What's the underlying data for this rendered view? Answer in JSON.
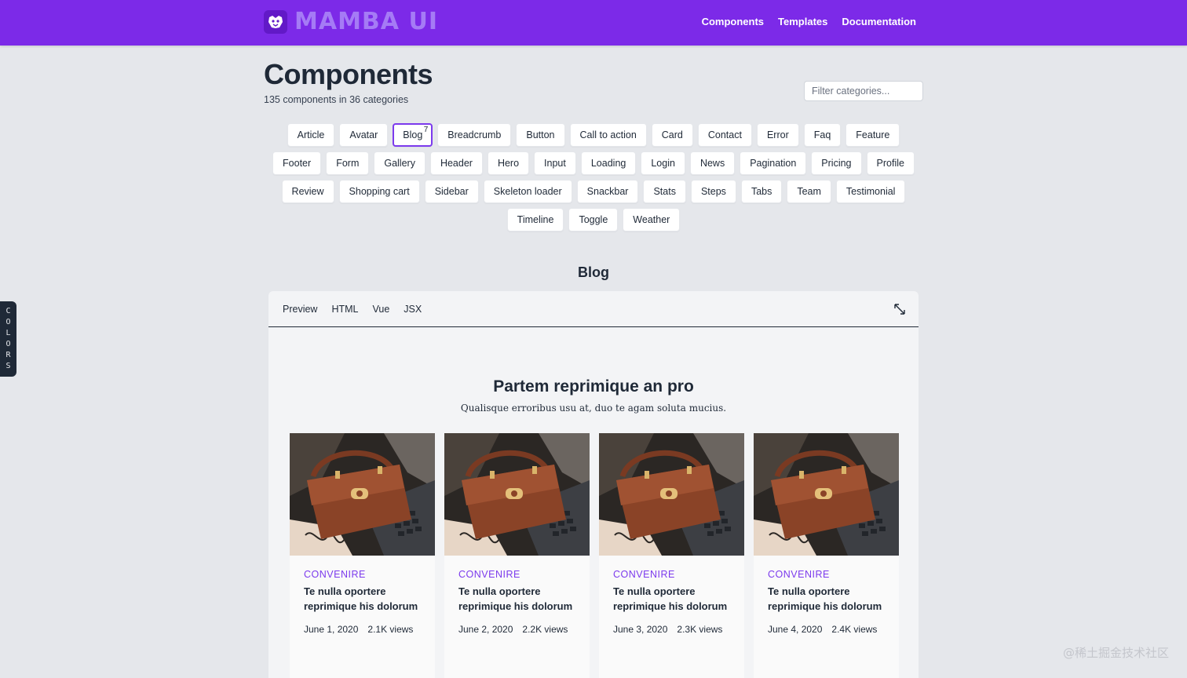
{
  "navbar": {
    "brand": "MAMBA UI",
    "links": [
      "Components",
      "Templates",
      "Documentation"
    ]
  },
  "colors_tab": [
    "C",
    "O",
    "L",
    "O",
    "R",
    "S"
  ],
  "page": {
    "title": "Components",
    "subtitle": "135 components in 36 categories",
    "filter_placeholder": "Filter categories..."
  },
  "categories": [
    "Article",
    "Avatar",
    "Blog",
    "Breadcrumb",
    "Button",
    "Call to action",
    "Card",
    "Contact",
    "Error",
    "Faq",
    "Feature",
    "Footer",
    "Form",
    "Gallery",
    "Header",
    "Hero",
    "Input",
    "Loading",
    "Login",
    "News",
    "Pagination",
    "Pricing",
    "Profile",
    "Review",
    "Shopping cart",
    "Sidebar",
    "Skeleton loader",
    "Snackbar",
    "Stats",
    "Steps",
    "Tabs",
    "Team",
    "Testimonial",
    "Timeline",
    "Toggle",
    "Weather"
  ],
  "active_category": {
    "label": "Blog",
    "count": "7"
  },
  "section": {
    "title": "Blog"
  },
  "panel": {
    "tabs": [
      "Preview",
      "HTML",
      "Vue",
      "JSX"
    ],
    "expand_icon": "expand-icon"
  },
  "blog_preview": {
    "heading": "Partem reprimique an pro",
    "subheading": "Qualisque erroribus usu at, duo te agam soluta mucius.",
    "cards": [
      {
        "tag": "CONVENIRE",
        "title": "Te nulla oportere reprimique his dolorum",
        "date": "June 1, 2020",
        "views": "2.1K views"
      },
      {
        "tag": "CONVENIRE",
        "title": "Te nulla oportere reprimique his dolorum",
        "date": "June 2, 2020",
        "views": "2.2K views"
      },
      {
        "tag": "CONVENIRE",
        "title": "Te nulla oportere reprimique his dolorum",
        "date": "June 3, 2020",
        "views": "2.3K views"
      },
      {
        "tag": "CONVENIRE",
        "title": "Te nulla oportere reprimique his dolorum",
        "date": "June 4, 2020",
        "views": "2.4K views"
      }
    ]
  },
  "watermark": "@稀土掘金技术社区",
  "colors": {
    "navbar": "#7c2ae8",
    "accent": "#7c3aed",
    "page_bg": "#e5e7eb"
  }
}
